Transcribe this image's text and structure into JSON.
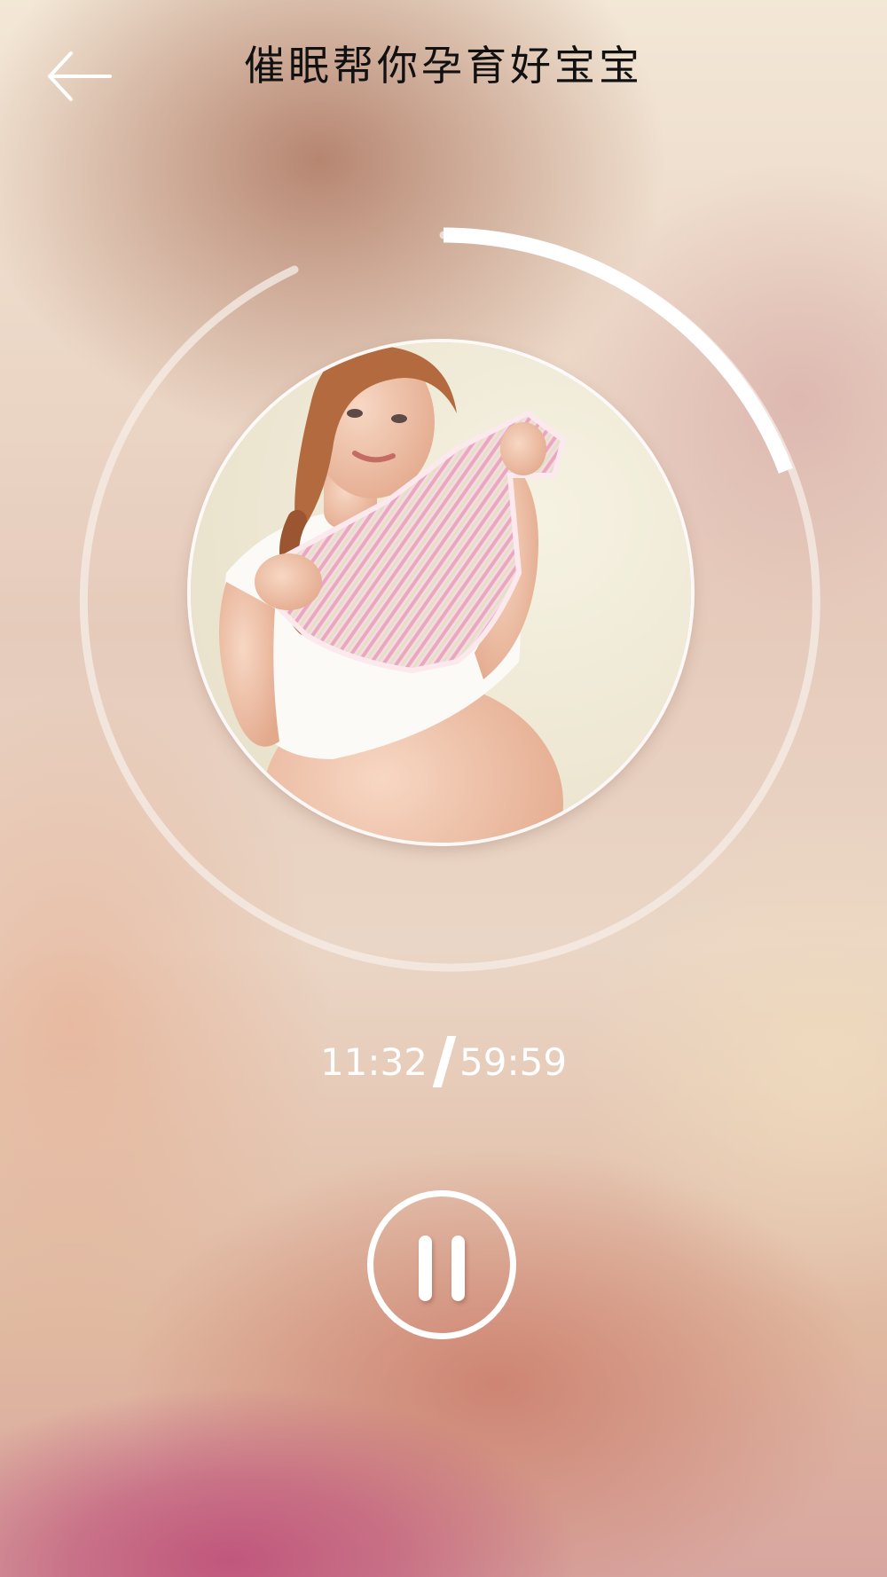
{
  "header": {
    "title": "催眠帮你孕育好宝宝",
    "back_icon": "arrow-left-icon"
  },
  "player": {
    "current_time": "11:32",
    "total_time": "59:59",
    "progress_fraction": 0.192,
    "pause_icon": "pause-icon",
    "cover_description_icon": "album-cover-image"
  },
  "colors": {
    "ring": "#f5ece6",
    "progress": "#ffffff",
    "text": "#ffffff",
    "title": "#111111",
    "accent_pink": "#c0567c"
  }
}
